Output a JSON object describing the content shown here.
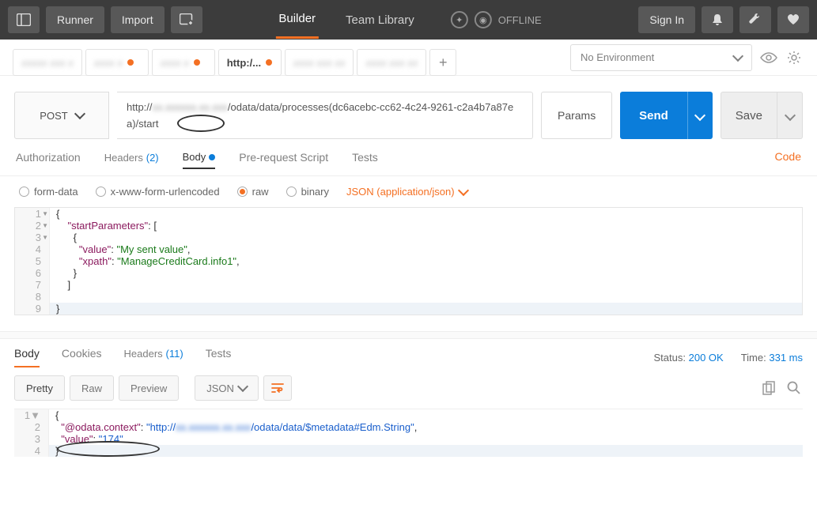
{
  "topbar": {
    "runner": "Runner",
    "import": "Import",
    "builder": "Builder",
    "team_library": "Team Library",
    "offline": "OFFLINE",
    "sign_in": "Sign In"
  },
  "env": {
    "selected": "No Environment"
  },
  "tabs": {
    "active_label": "http:/...",
    "add": "+"
  },
  "request": {
    "method": "POST",
    "url_prefix": "http://",
    "url_mid": "/odata/data/processes(dc6acebc-cc62-4c24-9261-c2a4b7a87e",
    "url_suffix": "a)/start",
    "params": "Params",
    "send": "Send",
    "save": "Save"
  },
  "subtabs": {
    "authorization": "Authorization",
    "headers": "Headers",
    "headers_count": "(2)",
    "body": "Body",
    "prerequest": "Pre-request Script",
    "tests": "Tests",
    "code": "Code"
  },
  "body_opts": {
    "form_data": "form-data",
    "urlencoded": "x-www-form-urlencoded",
    "raw": "raw",
    "binary": "binary",
    "content_type": "JSON (application/json)"
  },
  "request_body_lines": [
    "{",
    "    \"startParameters\": [",
    "      {",
    "        \"value\": \"My sent value\",",
    "        \"xpath\": \"ManageCreditCard.info1\",",
    "      }",
    "    ]",
    "",
    "}"
  ],
  "response": {
    "tabs": {
      "body": "Body",
      "cookies": "Cookies",
      "headers": "Headers",
      "headers_count": "(11)",
      "tests": "Tests"
    },
    "status_label": "Status:",
    "status_value": "200 OK",
    "time_label": "Time:",
    "time_value": "331 ms",
    "view": {
      "pretty": "Pretty",
      "raw": "Raw",
      "preview": "Preview",
      "format": "JSON"
    },
    "body_context_key": "\"@odata.context\"",
    "body_context_val_prefix": "\"http://",
    "body_context_val_suffix": "/odata/data/$metadata#Edm.String\"",
    "body_value_key": "\"value\"",
    "body_value_val": "\"174\""
  },
  "chart_data": null
}
